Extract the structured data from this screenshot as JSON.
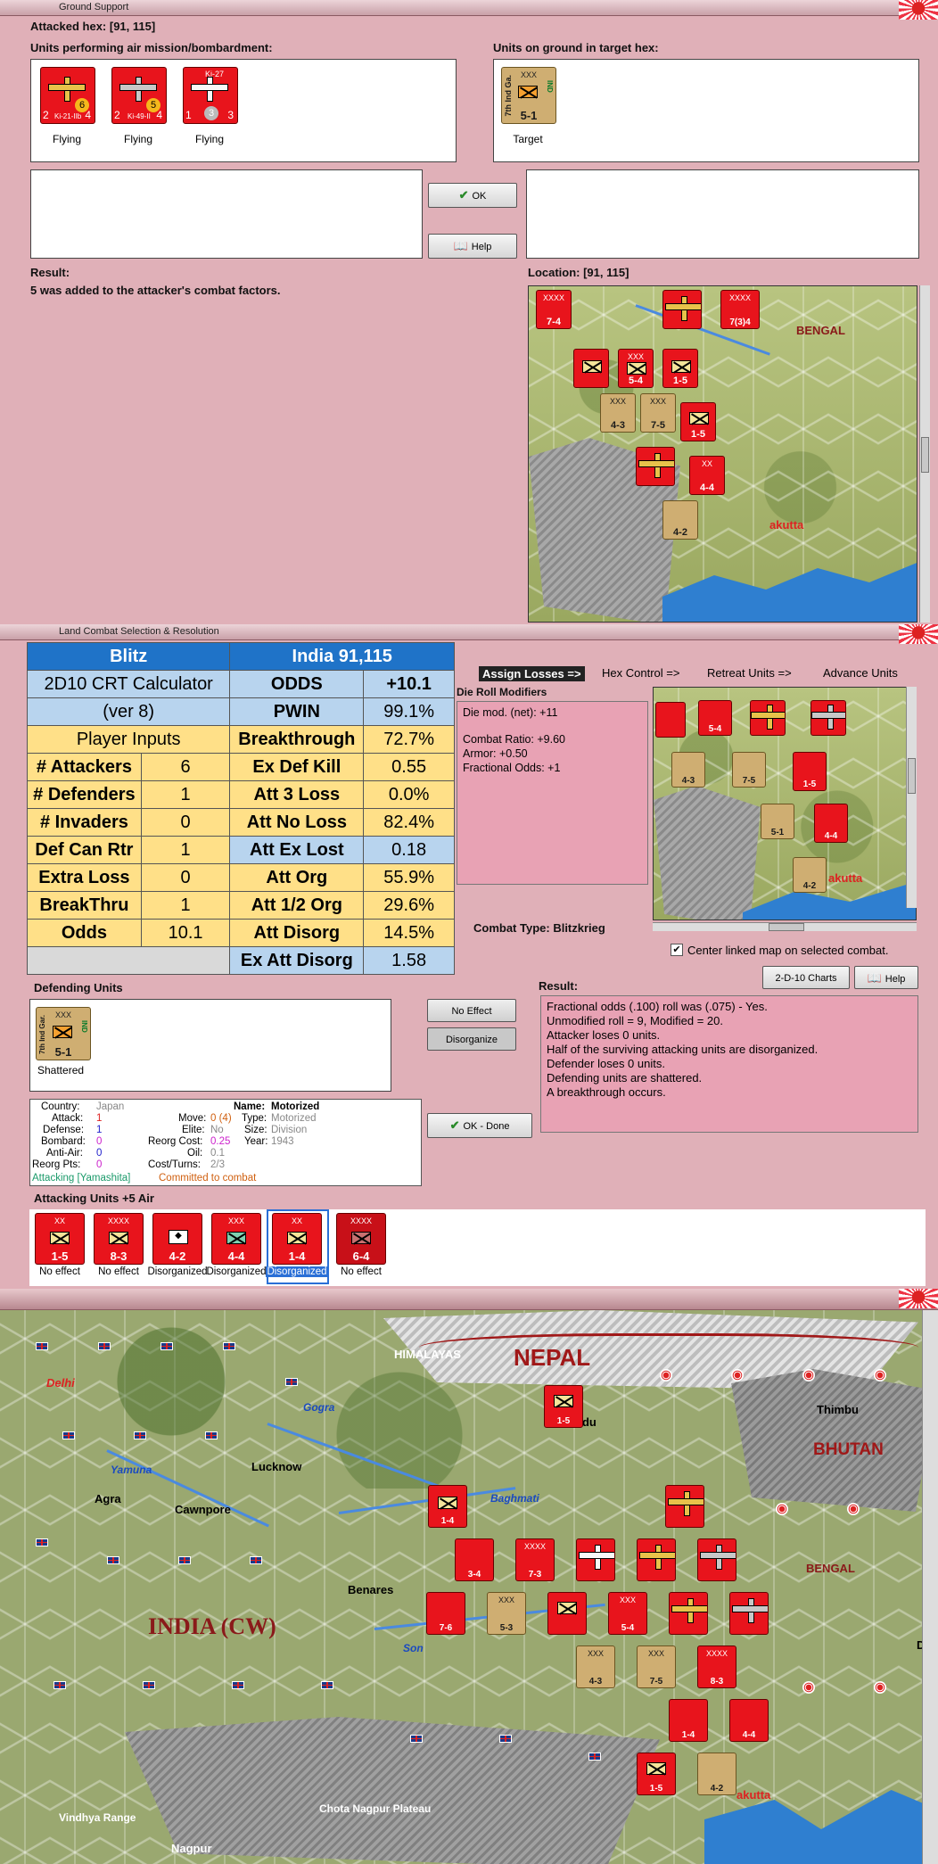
{
  "ground_support": {
    "title": "Ground Support",
    "attacked_hex": "Attacked hex:  [91, 115]",
    "air_label": "Units performing air mission/bombardment:",
    "ground_label": "Units on ground in target hex:",
    "air_units": [
      {
        "name": "Ki-21-IIb",
        "status": "Flying",
        "att": "2",
        "def": "4",
        "icon": "bomber-plane-icon",
        "badge": "6"
      },
      {
        "name": "Ki-49-II",
        "status": "Flying",
        "att": "2",
        "def": "4",
        "icon": "bomber-plane-icon",
        "badge": "5"
      },
      {
        "name": "Ki-27",
        "status": "Flying",
        "att": "1",
        "def": "3",
        "icon": "fighter-plane-icon",
        "badge": "3"
      }
    ],
    "ground_unit": {
      "side": "7th Ind Ga.",
      "size": "XXX",
      "nat": "IND",
      "str": "5-1",
      "status": "Target"
    },
    "ok_label": "OK",
    "help_label": "Help",
    "result_label": "Result:",
    "result_text": "5 was added to the attacker's combat factors.",
    "location": "Location:  [91, 115]"
  },
  "map_labels": {
    "bengal": "BENGAL",
    "calcutta": "akutta",
    "nepal": "NEPAL",
    "himalayas": "HIMALAYAS",
    "bhutan": "BHUTAN",
    "thimbu": "Thimbu",
    "india": "INDIA (CW)",
    "delhi": "Delhi",
    "agra": "Agra",
    "lucknow": "Lucknow",
    "cawnpore": "Cawnpore",
    "benares": "Benares",
    "gogra": "Gogra",
    "yamuna": "Yamuna",
    "baghmati": "Baghmati",
    "son": "Son",
    "vindhya": "Vindhya Range",
    "chota": "Chota Nagpur Plateau",
    "nagpur": "Nagpur",
    "dac": "Dac",
    "ndu": "ndu"
  },
  "land_combat": {
    "title": "Land Combat Selection & Resolution",
    "crt": {
      "header_left": "Blitz",
      "header_right": "India 91,115",
      "calc_title": "2D10 CRT Calculator",
      "calc_ver": "(ver 8)",
      "player_inputs": "Player Inputs",
      "inputs": [
        {
          "label": "# Attackers",
          "value": "6"
        },
        {
          "label": "# Defenders",
          "value": "1"
        },
        {
          "label": "# Invaders",
          "value": "0"
        },
        {
          "label": "Def Can Rtr",
          "value": "1"
        },
        {
          "label": "Extra Loss",
          "value": "0"
        },
        {
          "label": "BreakThru",
          "value": "1"
        },
        {
          "label": "Odds",
          "value": "10.1"
        }
      ],
      "results": [
        {
          "label": "ODDS",
          "value": "+10.1"
        },
        {
          "label": "PWIN",
          "value": "99.1%"
        },
        {
          "label": "Breakthrough",
          "value": "72.7%"
        },
        {
          "label": "Ex Def Kill",
          "value": "0.55"
        },
        {
          "label": "Att 3 Loss",
          "value": "0.0%"
        },
        {
          "label": "Att No Loss",
          "value": "82.4%"
        },
        {
          "label": "Att Ex Lost",
          "value": "0.18"
        },
        {
          "label": "Att Org",
          "value": "55.9%"
        },
        {
          "label": "Att 1/2 Org",
          "value": "29.6%"
        },
        {
          "label": "Att Disorg",
          "value": "14.5%"
        },
        {
          "label": "Ex Att Disorg",
          "value": "1.58"
        }
      ]
    },
    "tabs": [
      "Assign Losses =>",
      "Hex Control =>",
      "Retreat Units =>",
      "Advance Units"
    ],
    "die_roll_label": "Die Roll Modifiers",
    "die_roll_lines": [
      "Die mod. (net): +11",
      "",
      "Combat Ratio: +9.60",
      "Armor: +0.50",
      "Fractional Odds: +1"
    ],
    "combat_type": "Combat Type: Blitzkrieg",
    "center_linked": "Center linked map on selected combat.",
    "charts_label": "2-D-10 Charts",
    "help_label": "Help",
    "defending_label": "Defending Units",
    "defender": {
      "side": "7th Ind Gar.",
      "size": "XXX",
      "nat": "IND",
      "str": "5-1",
      "status": "Shattered"
    },
    "no_effect_label": "No Effect",
    "disorganize_label": "Disorganize",
    "ok_done_label": "OK - Done",
    "result_label": "Result:",
    "result_lines": [
      "Fractional odds (.100) roll was (.075)  - Yes.",
      "Unmodified roll = 9, Modified = 20.",
      "Attacker loses 0 units.",
      "Half of the surviving attacking units are disorganized.",
      "Defender loses 0 units.",
      "Defending units are shattered.",
      "A breakthrough occurs."
    ],
    "info": {
      "country_label": "Country:",
      "country": "Japan",
      "attack_label": "Attack:",
      "attack": "1",
      "defense_label": "Defense:",
      "defense": "1",
      "bombard_label": "Bombard:",
      "bombard": "0",
      "antiair_label": "Anti-Air:",
      "antiair": "0",
      "reorg_label": "Reorg Pts:",
      "reorg": "0",
      "name_label": "Name:",
      "name": "Motorized",
      "move_label": "Move:",
      "move": "0 (4)",
      "type_label": "Type:",
      "type": "Motorized",
      "elite_label": "Elite:",
      "elite": "No",
      "size_label": "Size:",
      "size": "Division",
      "reorgcost_label": "Reorg Cost:",
      "reorgcost": "0.25",
      "year_label": "Year:",
      "year": "1943",
      "oil_label": "Oil:",
      "oil": "0.1",
      "costturns_label": "Cost/Turns:",
      "costturns": "2/3",
      "attacking": "Attacking [Yamashita]",
      "committed": "Committed to combat"
    },
    "attacking_label": "Attacking Units +5 Air",
    "attackers": [
      {
        "top": "XX",
        "str": "1-5",
        "status": "No effect",
        "selected": false
      },
      {
        "top": "XXXX",
        "str": "8-3",
        "status": "No effect",
        "selected": false
      },
      {
        "top": "",
        "str": "4-2",
        "status": "Disorganized",
        "selected": false
      },
      {
        "top": "XXX",
        "str": "4-4",
        "status": "Disorganized",
        "selected": false
      },
      {
        "top": "XX",
        "str": "1-4",
        "status": "Disorganized",
        "selected": true
      },
      {
        "top": "XXXX",
        "str": "6-4",
        "status": "No effect",
        "selected": false
      }
    ]
  },
  "colors": {
    "pink_bg": "#e0b0b8",
    "crt_blue": "#1f73c8",
    "crt_yellow": "#ffe088",
    "jp_red": "#e8141c",
    "selection_blue": "#2a6fd6"
  }
}
